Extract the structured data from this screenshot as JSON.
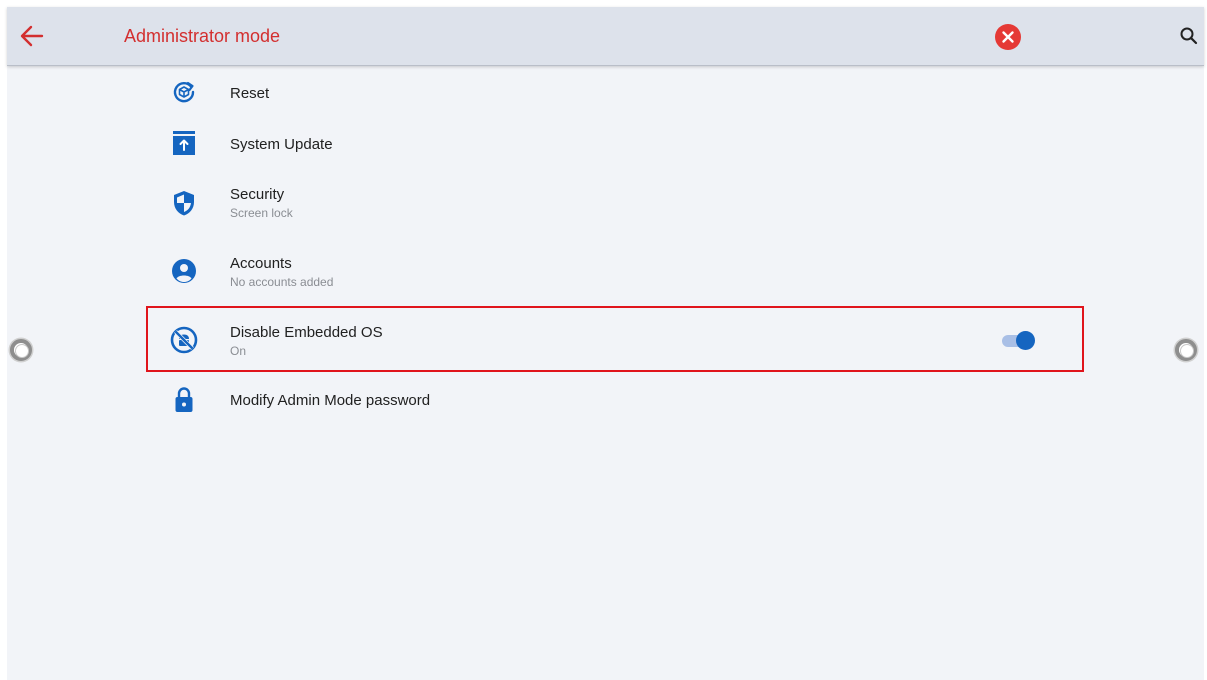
{
  "header": {
    "title": "Administrator mode",
    "back_icon": "arrow-back-icon",
    "close_icon": "close-circle-icon",
    "search_icon": "search-icon"
  },
  "colors": {
    "accent": "#d32f2f",
    "primary_blue": "#1565c0",
    "highlight_border": "#e0141c",
    "appbar_bg": "#dde2eb",
    "page_bg": "#f2f4f8"
  },
  "settings": {
    "items": [
      {
        "label": "Reset",
        "icon": "reset-icon"
      },
      {
        "label": "System Update",
        "icon": "system-update-icon"
      },
      {
        "label": "Security",
        "sub": "Screen lock",
        "icon": "shield-icon"
      },
      {
        "label": "Accounts",
        "sub": "No accounts added",
        "icon": "account-circle-icon"
      },
      {
        "label": "Disable Embedded OS",
        "sub": "On",
        "icon": "android-off-icon",
        "toggle_on": true
      },
      {
        "label": "Modify Admin Mode password",
        "icon": "lock-icon"
      }
    ]
  }
}
